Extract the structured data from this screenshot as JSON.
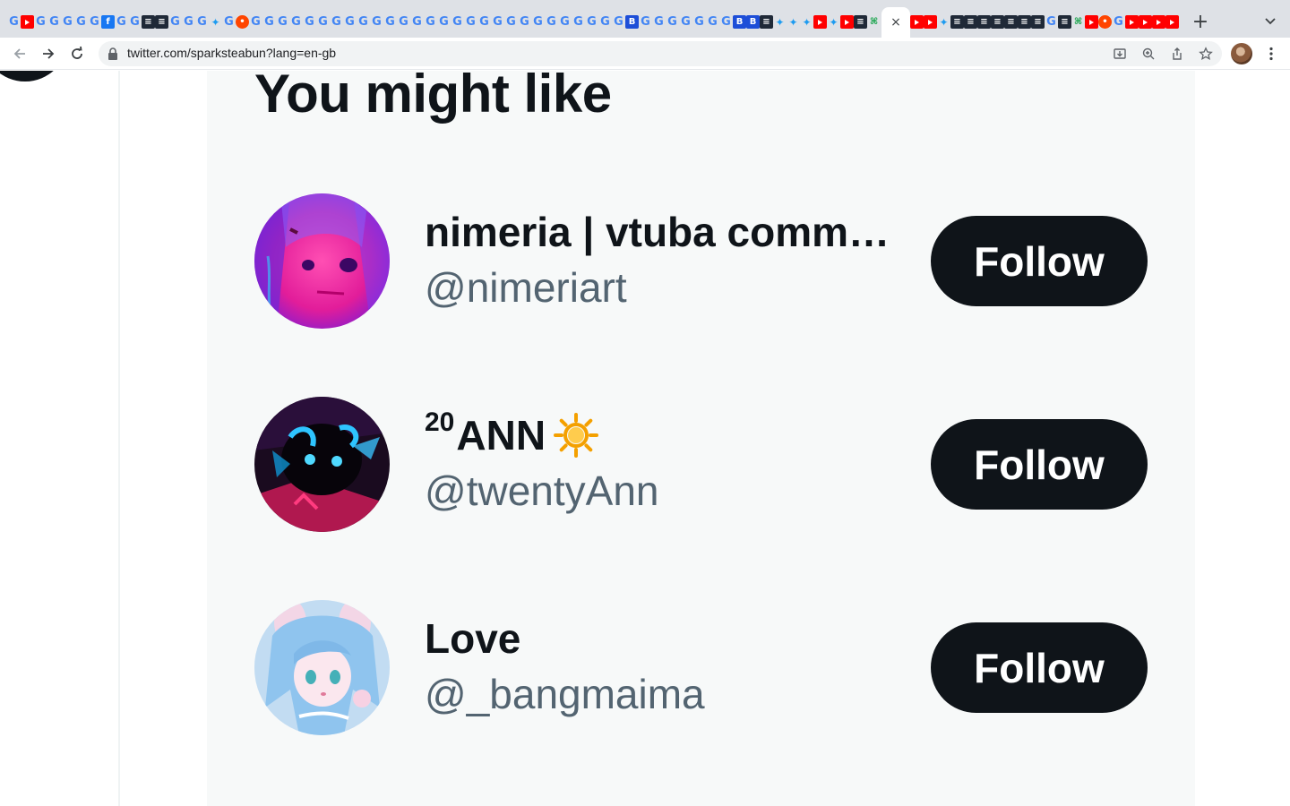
{
  "browser": {
    "url": "twitter.com/sparksteabun?lang=en-gb",
    "tab_icons": [
      "g",
      "yt",
      "g",
      "g",
      "g",
      "g",
      "g",
      "fb",
      "g",
      "g",
      "dark",
      "dark",
      "g",
      "g",
      "g",
      "tw",
      "g",
      "reddit",
      "g",
      "g",
      "g",
      "g",
      "g",
      "g",
      "g",
      "g",
      "g",
      "g",
      "g",
      "g",
      "g",
      "g",
      "g",
      "g",
      "g",
      "g",
      "g",
      "g",
      "g",
      "g",
      "g",
      "g",
      "g",
      "g",
      "g",
      "g",
      "blue",
      "g",
      "g",
      "g",
      "g",
      "g",
      "g",
      "g",
      "blue",
      "blue",
      "dark",
      "tw",
      "tw",
      "tw",
      "yt",
      "tw",
      "yt",
      "dark",
      "green"
    ],
    "tab_icons_right": [
      "yt",
      "yt",
      "tw",
      "dark",
      "dark",
      "dark",
      "dark",
      "dark",
      "dark",
      "dark",
      "g",
      "dark",
      "green",
      "yt",
      "reddit",
      "g",
      "yt",
      "yt",
      "yt",
      "yt"
    ],
    "active_tab_close": "×",
    "new_tab": "+"
  },
  "panel": {
    "title": "You might like"
  },
  "suggestions": [
    {
      "display_name": "nimeria | vtuba comm…",
      "handle": "@nimeriart",
      "follow_label": "Follow"
    },
    {
      "display_name_sup": "20",
      "display_name": "ANN",
      "emoji": "sun",
      "handle": "@twentyAnn",
      "follow_label": "Follow"
    },
    {
      "display_name": "Love",
      "handle": "@_bangmaima",
      "follow_label": "Follow"
    }
  ],
  "colors": {
    "panel_bg": "#f7f9f9",
    "text_primary": "#0f1419",
    "text_secondary": "#536471",
    "button_bg": "#0f1419",
    "button_text": "#ffffff"
  }
}
